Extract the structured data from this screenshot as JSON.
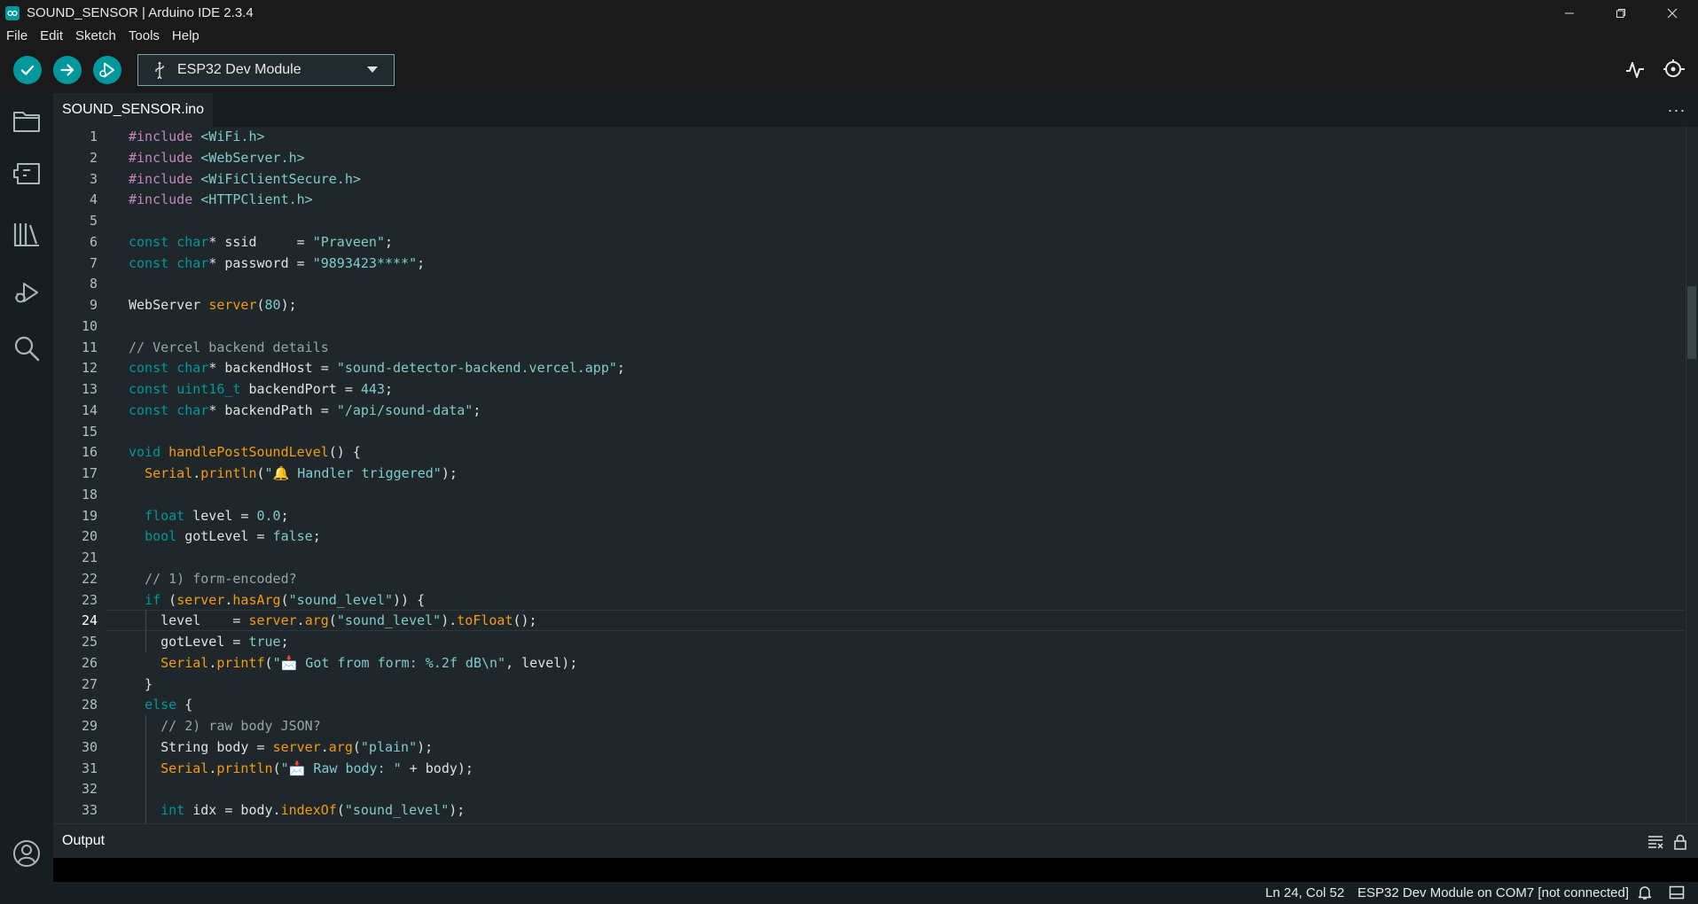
{
  "window": {
    "title": "SOUND_SENSOR | Arduino IDE 2.3.4",
    "controls": [
      "minimize",
      "restore",
      "close"
    ]
  },
  "menu": [
    "File",
    "Edit",
    "Sketch",
    "Tools",
    "Help"
  ],
  "toolbar": {
    "verify_icon": "checkmark-icon",
    "upload_icon": "arrow-right-icon",
    "debug_icon": "debug-icon",
    "board_label": "ESP32 Dev Module",
    "serial_plotter_icon": "plotter-icon",
    "serial_monitor_icon": "monitor-icon"
  },
  "sidebar": [
    "folder-icon",
    "board-manager-icon",
    "library-icon",
    "debug-icon",
    "search-icon",
    "account-icon"
  ],
  "tabs": [
    {
      "label": "SOUND_SENSOR.ino"
    }
  ],
  "editor": {
    "active_line": 24,
    "lines": [
      "#include <WiFi.h>",
      "#include <WebServer.h>",
      "#include <WiFiClientSecure.h>",
      "#include <HTTPClient.h>",
      "",
      "const char* ssid     = \"Praveen\";",
      "const char* password = \"9893423****\";",
      "",
      "WebServer server(80);",
      "",
      "// Vercel backend details",
      "const char* backendHost = \"sound-detector-backend.vercel.app\";",
      "const uint16_t backendPort = 443;",
      "const char* backendPath = \"/api/sound-data\";",
      "",
      "void handlePostSoundLevel() {",
      "  Serial.println(\"🔔 Handler triggered\");",
      "",
      "  float level = 0.0;",
      "  bool gotLevel = false;",
      "",
      "  // 1) form-encoded?",
      "  if (server.hasArg(\"sound_level\")) {",
      "    level    = server.arg(\"sound_level\").toFloat();",
      "    gotLevel = true;",
      "    Serial.printf(\"📩 Got from form: %.2f dB\\n\", level);",
      "  }",
      "  else {",
      "    // 2) raw body JSON?",
      "    String body = server.arg(\"plain\");",
      "    Serial.println(\"📩 Raw body: \" + body);",
      "",
      "    int idx = body.indexOf(\"sound_level\");"
    ]
  },
  "output": {
    "title": "Output"
  },
  "status": {
    "position": "Ln 24, Col 52",
    "board": "ESP32 Dev Module on COM7 [not connected]"
  }
}
